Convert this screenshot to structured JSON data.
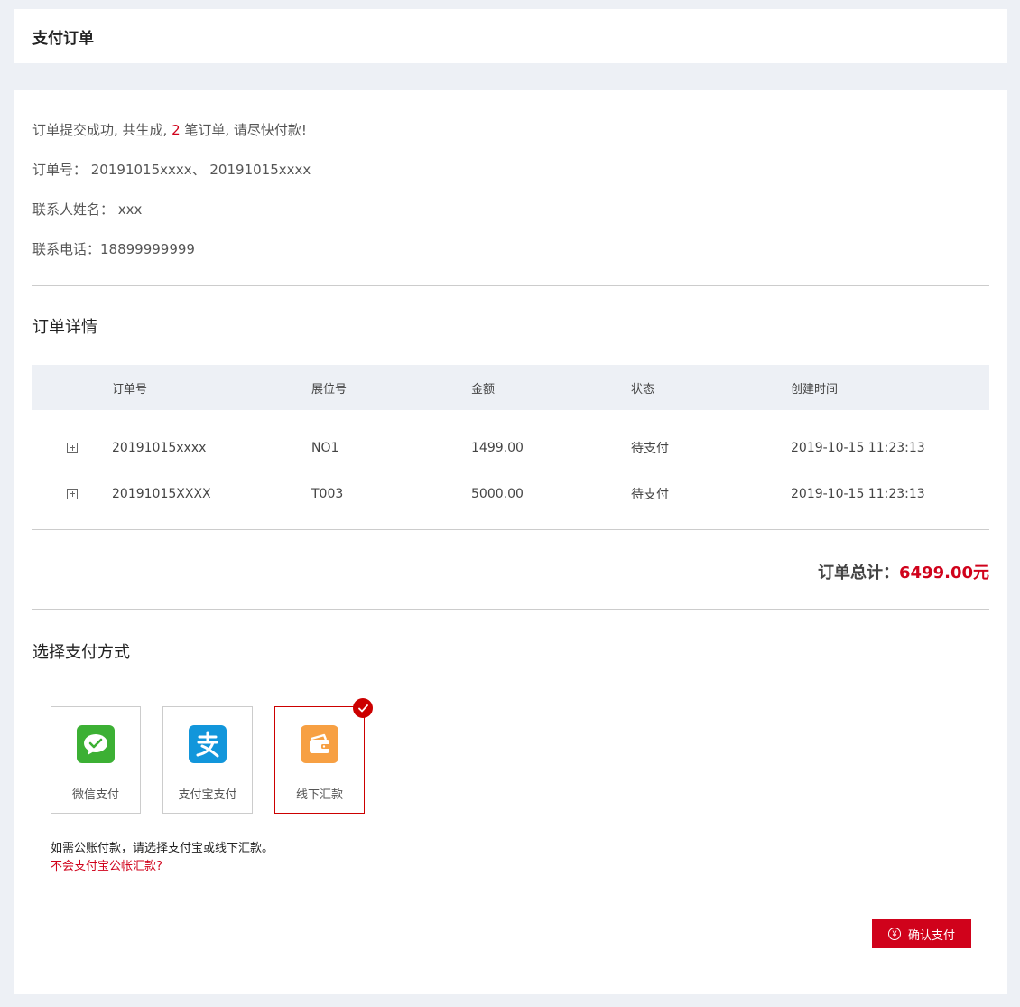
{
  "header": {
    "title": "支付订单"
  },
  "summary": {
    "line1_prefix": "订单提交成功, 共生成, ",
    "order_count": "2",
    "line1_suffix": " 笔订单, 请尽快付款!",
    "order_numbers": "订单号： 20191015xxxx、 20191015xxxx",
    "contact_name": "联系人姓名： xxx",
    "contact_phone": "联系电话：18899999999"
  },
  "details": {
    "title": "订单详情",
    "columns": [
      "订单号",
      "展位号",
      "金额",
      "状态",
      "创建时间"
    ],
    "rows": [
      {
        "order_no": "20191015xxxx",
        "booth": "NO1",
        "amount": "1499.00",
        "status": "待支付",
        "created": "2019-10-15 11:23:13"
      },
      {
        "order_no": "20191015XXXX",
        "booth": "T003",
        "amount": "5000.00",
        "status": "待支付",
        "created": "2019-10-15 11:23:13"
      }
    ]
  },
  "total": {
    "label": "订单总计：",
    "amount": "6499.00元"
  },
  "payment": {
    "title": "选择支付方式",
    "methods": [
      {
        "label": "微信支付",
        "icon": "wechat-icon",
        "color": "#3cb034",
        "selected": false
      },
      {
        "label": "支付宝支付",
        "icon": "alipay-icon",
        "color": "#1296db",
        "selected": false
      },
      {
        "label": "线下汇款",
        "icon": "wallet-icon",
        "color": "#f7a043",
        "selected": true
      }
    ],
    "note": "如需公账付款，请选择支付宝或线下汇款。",
    "help_link": "不会支付宝公帐汇款?"
  },
  "confirm": {
    "label": "确认支付",
    "icon": "yen-icon",
    "icon_glyph": "¥"
  },
  "colors": {
    "accent": "#d0021b",
    "background": "#edf0f5"
  }
}
